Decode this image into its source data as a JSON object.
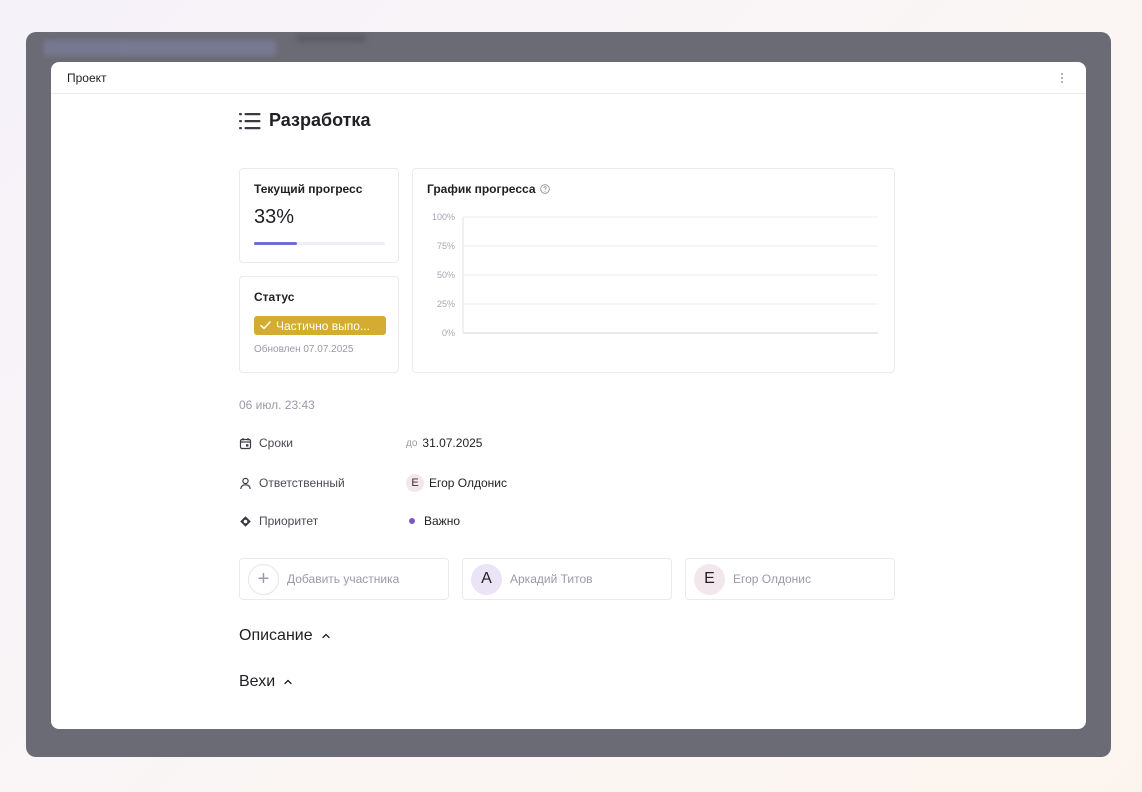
{
  "window": {
    "title": "Проект"
  },
  "page": {
    "heading": "Разработка"
  },
  "progress_card": {
    "title": "Текущий прогресс",
    "value_text": "33%",
    "fraction": 0.33,
    "color": "#6b6fd6"
  },
  "status_card": {
    "title": "Статус",
    "badge": "Частично выпо...",
    "badge_color": "#d4ac32",
    "updated": "Обновлен 07.07.2025"
  },
  "chart_card": {
    "title": "График прогресса"
  },
  "chart_data": {
    "type": "line",
    "title": "График прогресса",
    "xlabel": "",
    "ylabel": "",
    "ylim": [
      0,
      100
    ],
    "yticks": [
      "100%",
      "75%",
      "50%",
      "25%",
      "0%"
    ],
    "grid": true,
    "series": []
  },
  "timestamp": "06 июл. 23:43",
  "properties": {
    "deadline": {
      "label": "Сроки",
      "prefix": "до",
      "value": "31.07.2025",
      "icon": "calendar-icon"
    },
    "assignee": {
      "label": "Ответственный",
      "initial": "Е",
      "value": "Егор Олдонис",
      "icon": "person-icon"
    },
    "priority": {
      "label": "Приоритет",
      "value": "Важно",
      "dot_color": "#7f56c4",
      "icon": "priority-icon"
    }
  },
  "members": {
    "add_label": "Добавить участника",
    "list": [
      {
        "initial": "А",
        "name": "Аркадий Титов",
        "color": "#ebe4f6"
      },
      {
        "initial": "Е",
        "name": "Егор Олдонис",
        "color": "#f3e7ee"
      }
    ]
  },
  "sections": {
    "description": "Описание",
    "milestones": "Вехи"
  }
}
